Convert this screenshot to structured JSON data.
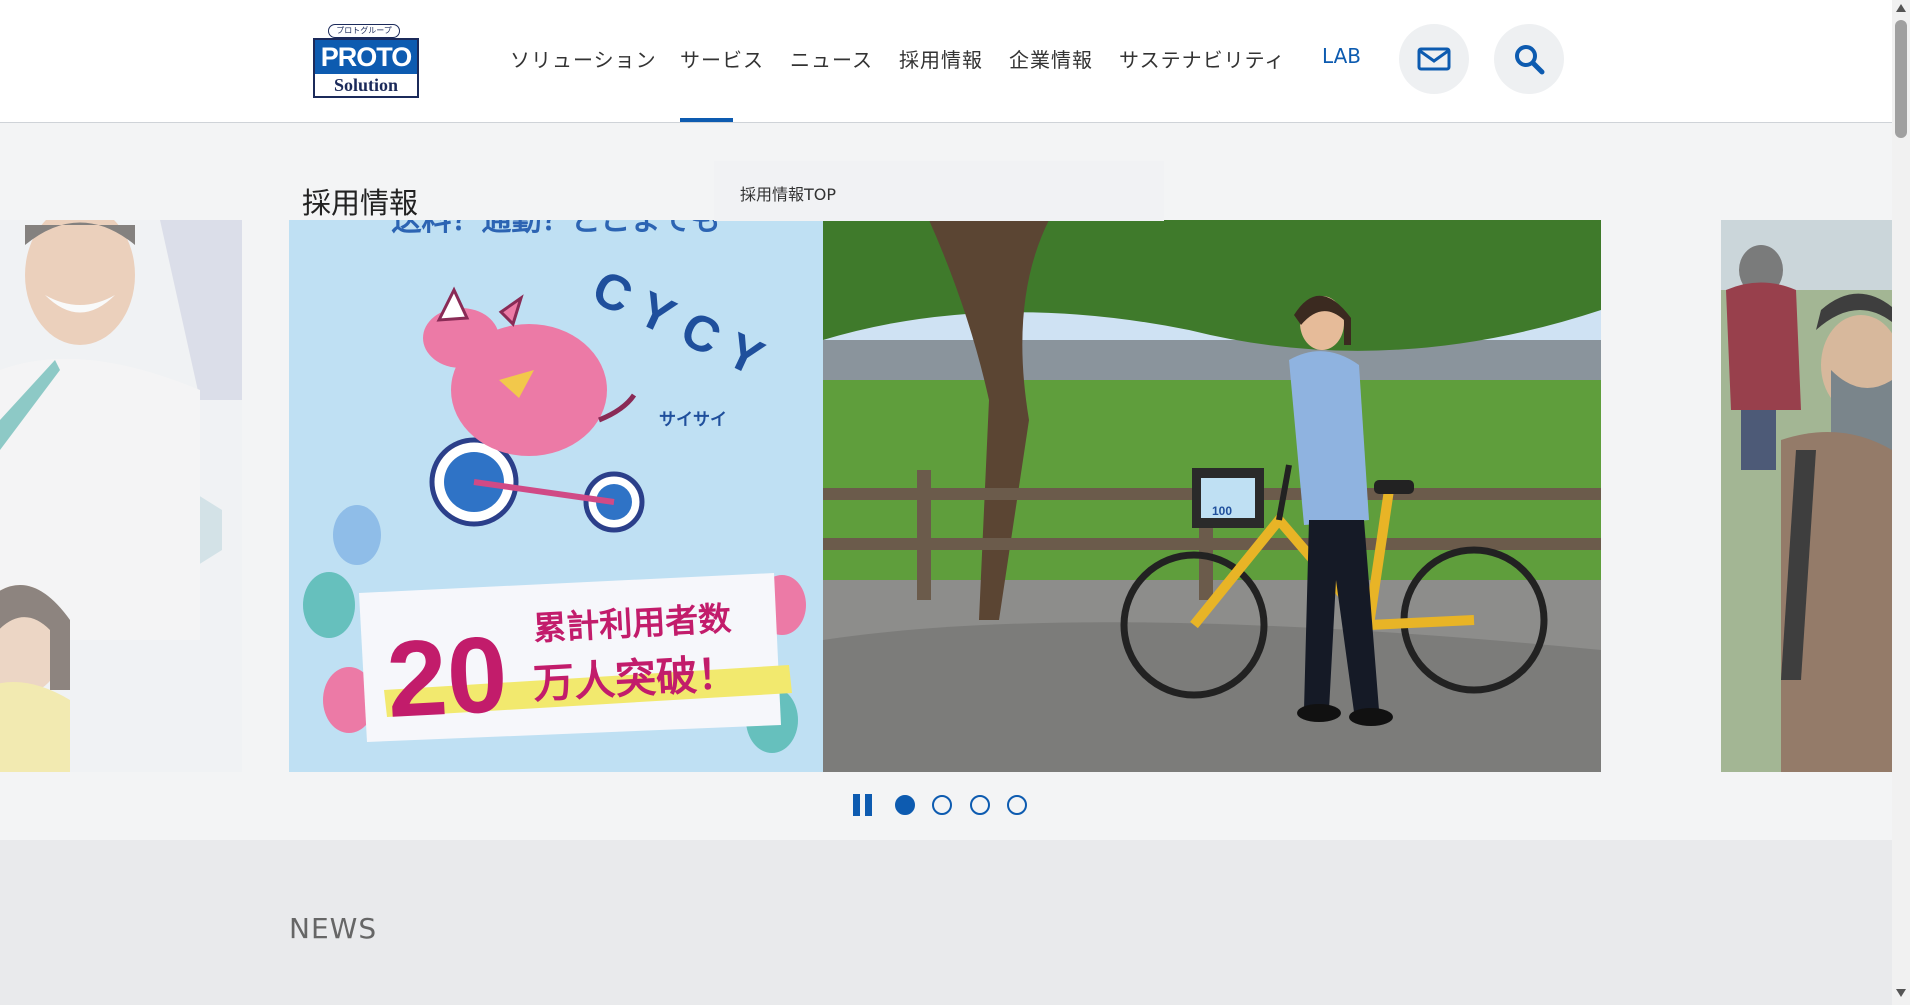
{
  "brand": {
    "tag": "プロトグループ",
    "name_top": "PROTO",
    "name_bottom": "Solution"
  },
  "nav": {
    "items": [
      {
        "label": "ソリューション"
      },
      {
        "label": "サービス"
      },
      {
        "label": "ニュース"
      },
      {
        "label": "採用情報"
      },
      {
        "label": "企業情報"
      },
      {
        "label": "サステナビリティ"
      },
      {
        "label": "LAB"
      }
    ],
    "active": "サービス",
    "icons": [
      "mail-icon",
      "search-icon"
    ]
  },
  "submenu": {
    "title": "採用情報",
    "items": [
      {
        "label": "採用情報TOP"
      }
    ]
  },
  "slider": {
    "banner": {
      "top_text": "送料？通勤？どこまでも",
      "brand_text": "CYCY",
      "brand_kana": "サイサイ",
      "count": "20",
      "line1": "累計利用者数",
      "line2": "万人突破！"
    },
    "basket_label": "100",
    "dots_total": 4,
    "active_index": 0,
    "accent_color": "#0d5bb0"
  },
  "news": {
    "title": "NEWS"
  }
}
